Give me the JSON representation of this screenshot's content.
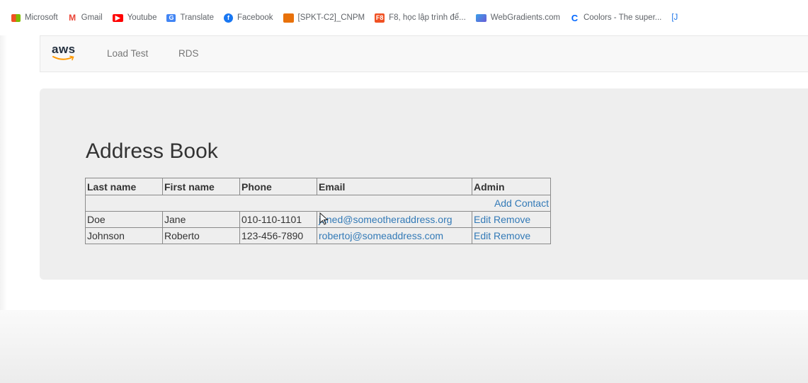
{
  "bookmarks": [
    {
      "label": "Microsoft",
      "icon": "microsoft-icon",
      "color": "#f25022"
    },
    {
      "label": "Gmail",
      "icon": "gmail-icon",
      "color": "#ea4335"
    },
    {
      "label": "Youtube",
      "icon": "youtube-icon",
      "color": "#ff0000"
    },
    {
      "label": "Translate",
      "icon": "translate-icon",
      "color": "#4285f4"
    },
    {
      "label": "Facebook",
      "icon": "facebook-icon",
      "color": "#1877f2"
    },
    {
      "label": "[SPKT-C2]_CNPM",
      "icon": "folder-icon",
      "color": "#e8710a"
    },
    {
      "label": "F8, học lập trình để...",
      "icon": "f8-icon",
      "color": "#f05123"
    },
    {
      "label": "WebGradients.com",
      "icon": "webgradients-icon",
      "color": "#3aa0e8"
    },
    {
      "label": "Coolors - The super...",
      "icon": "coolors-icon",
      "color": "#0066ff"
    },
    {
      "label": "[J",
      "icon": "bookmark-icon",
      "color": "#1a73e8"
    }
  ],
  "nav": {
    "brand": "aws",
    "links": [
      "Load Test",
      "RDS"
    ]
  },
  "page": {
    "title": "Address Book"
  },
  "table": {
    "headers": [
      "Last name",
      "First name",
      "Phone",
      "Email",
      "Admin"
    ],
    "add_label": "Add Contact",
    "rows": [
      {
        "last": "Doe",
        "first": "Jane",
        "phone": "010-110-1101",
        "email": "janed@someotheraddress.org",
        "edit": "Edit",
        "remove": "Remove"
      },
      {
        "last": "Johnson",
        "first": "Roberto",
        "phone": "123-456-7890",
        "email": "robertoj@someaddress.com",
        "edit": "Edit",
        "remove": "Remove"
      }
    ]
  },
  "colors": {
    "link": "#337ab7",
    "jumbotron": "#eeeeee",
    "aws_orange": "#ff9900"
  }
}
